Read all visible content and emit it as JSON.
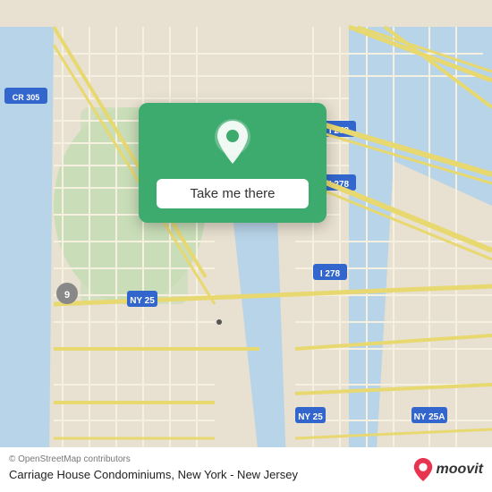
{
  "map": {
    "background_color": "#e8e0d0",
    "alt": "Map of New York - New Jersey area"
  },
  "card": {
    "button_label": "Take me there",
    "pin_icon": "location-pin"
  },
  "bottom_bar": {
    "copyright": "© OpenStreetMap contributors",
    "location_title": "Carriage House Condominiums, New York - New\nJersey",
    "moovit_label": "moovit"
  }
}
